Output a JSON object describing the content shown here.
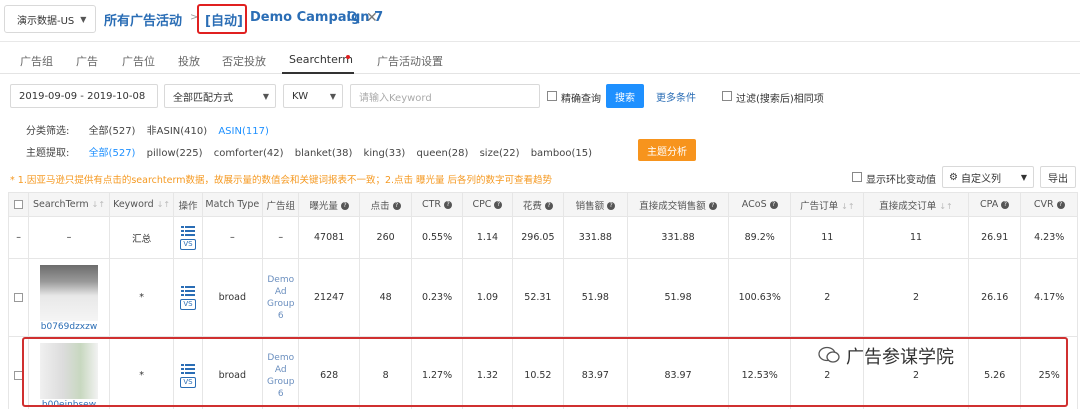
{
  "topbar": {
    "dataset": "演示数据-US",
    "all_campaigns": "所有广告活动",
    "separator": ">",
    "auto_tag": "[自动]",
    "campaign_name": "Demo Campaign 7"
  },
  "tabs": [
    "广告组",
    "广告",
    "广告位",
    "投放",
    "否定投放",
    "Searchterm",
    "广告活动设置"
  ],
  "active_tab": "Searchterm",
  "filters": {
    "date_range": "2019-09-09 - 2019-10-08",
    "match_mode": "全部匹配方式",
    "kw": "KW",
    "keyword_placeholder": "请输入Keyword",
    "exact_query": "精确查询",
    "search_button": "搜索",
    "more_conditions": "更多条件",
    "filter_after_search": "过滤(搜索后)相同项"
  },
  "category_filter": {
    "label": "分类筛选:",
    "options": [
      "全部(527)",
      "非ASIN(410)",
      "ASIN(117)"
    ]
  },
  "topic_filter": {
    "label": "主题提取:",
    "options": [
      "全部(527)",
      "pillow(225)",
      "comforter(42)",
      "blanket(38)",
      "king(33)",
      "queen(28)",
      "size(22)",
      "bamboo(15)"
    ],
    "analyze_button": "主题分析"
  },
  "notice": "* 1.因亚马逊只提供有点击的searchterm数据，故展示量的数值会和关键词报表不一致；2.点击 曝光量 后各列的数字可查看趋势",
  "table_controls": {
    "show_compare": "显示环比变动值",
    "custom_columns": "自定义列",
    "export": "导出"
  },
  "table": {
    "headers": [
      "SearchTerm",
      "Keyword",
      "操作",
      "Match Type",
      "广告组",
      "曝光量",
      "点击",
      "CTR",
      "CPC",
      "花费",
      "销售额",
      "直接成交销售额",
      "ACoS",
      "广告订单",
      "直接成交订单",
      "CPA",
      "CVR"
    ],
    "summary": [
      "–",
      "汇总",
      "–",
      "–",
      "47081",
      "260",
      "0.55%",
      "1.14",
      "296.05",
      "331.88",
      "331.88",
      "89.2%",
      "11",
      "11",
      "26.91",
      "4.23%"
    ],
    "summary_first": "–",
    "rows": [
      {
        "asin": "b0769dzxzw",
        "keyword": "*",
        "match": "broad",
        "group": "Demo Ad Group 6",
        "impr": "21247",
        "clicks": "48",
        "ctr": "0.23%",
        "cpc": "1.09",
        "spend": "52.31",
        "sales": "51.98",
        "direct_sales": "51.98",
        "acos": "100.63%",
        "orders": "2",
        "direct_orders": "2",
        "cpa": "26.16",
        "cvr": "4.17%"
      },
      {
        "asin": "b00einbsew",
        "keyword": "*",
        "match": "broad",
        "group": "Demo Ad Group 6",
        "impr": "628",
        "clicks": "8",
        "ctr": "1.27%",
        "cpc": "1.32",
        "spend": "10.52",
        "sales": "83.97",
        "direct_sales": "83.97",
        "acos": "12.53%",
        "orders": "2",
        "direct_orders": "2",
        "cpa": "5.26",
        "cvr": "25%"
      }
    ],
    "vs_label": "VS"
  },
  "watermark": "广告参谋学院",
  "colors": {
    "accent": "#1e90ff",
    "orange": "#f7941d",
    "highlight": "#d03030"
  }
}
